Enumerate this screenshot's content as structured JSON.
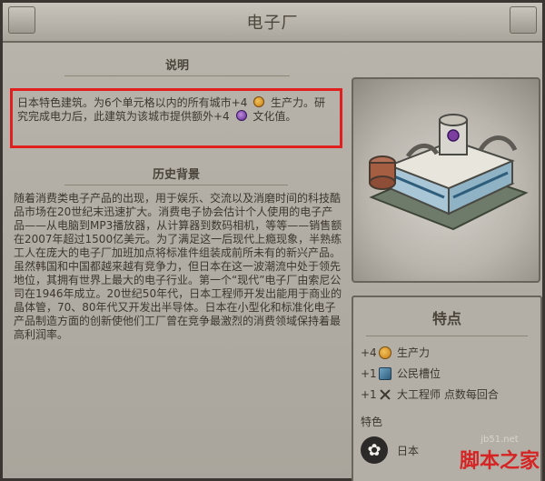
{
  "window": {
    "title": "电子厂"
  },
  "description": {
    "header": "说明",
    "text_part1": "日本特色建筑。为6个单元格以内的所有城市+4",
    "text_part2": "生产力。研究完成电力后，此建筑为该城市提供额外+4",
    "text_part3": "文化值。"
  },
  "history": {
    "header": "历史背景",
    "body": "随着消费类电子产品的出现，用于娱乐、交流以及消磨时间的科技酷品市场在20世纪末迅速扩大。消费电子协会估计个人使用的电子产品——从电脑到MP3播放器，从计算器到数码相机，等等——销售额在2007年超过1500亿美元。为了满足这一后现代上瘾现象，半熟练工人在庞大的电子厂加班加点将标准件组装成前所未有的新兴产品。虽然韩国和中国都越来越有竞争力，但日本在这一波潮流中处于领先地位，其拥有世界上最大的电子行业。第一个“现代”电子厂由索尼公司在1946年成立。20世纪50年代，日本工程师开发出能用于商业的晶体管，70、80年代又开发出半导体。日本在小型化和标准化电子产品制造方面的创新使他们工厂曾在竞争最激烈的消费领域保持着最高利润率。"
  },
  "features": {
    "title": "特点",
    "items": [
      {
        "amount": "+4",
        "icon": "production-coin-icon",
        "label": "生产力"
      },
      {
        "amount": "+1",
        "icon": "citizen-slot-icon",
        "label": "公民槽位"
      },
      {
        "amount": "+1",
        "icon": "great-engineer-icon",
        "label": "大工程师 点数每回合"
      }
    ],
    "special_label": "特色",
    "unique": {
      "icon": "sakura-icon",
      "label": "日本"
    }
  },
  "watermark": {
    "site": "jb51.net",
    "brand": "脚本之家"
  }
}
